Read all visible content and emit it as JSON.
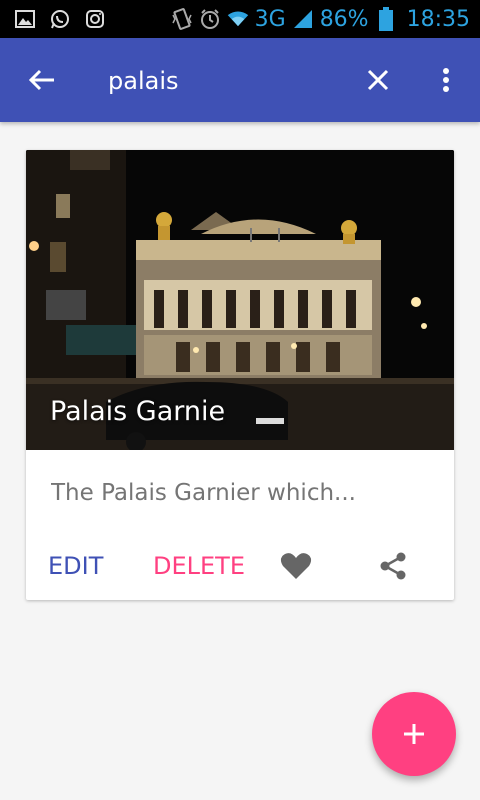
{
  "status_bar": {
    "network": "3G",
    "battery": "86%",
    "time": "18:35",
    "icons": [
      "gallery-icon",
      "whatsapp-icon",
      "instagram-icon",
      "vibrate-icon",
      "alarm-icon",
      "wifi-icon",
      "signal-icon",
      "battery-icon"
    ]
  },
  "app_bar": {
    "search_value": "palais",
    "color": "#3f51b5",
    "back_icon": "arrow-left-icon",
    "clear_icon": "close-icon",
    "more_icon": "more-vert-icon"
  },
  "card": {
    "title": "Palais Garnie",
    "description": "The Palais Garnier which...",
    "image_subject": "palais-garnier-night-photo",
    "actions": {
      "edit_label": "EDIT",
      "delete_label": "DELETE",
      "favorite_icon": "heart-icon",
      "share_icon": "share-icon"
    },
    "colors": {
      "edit": "#3f51b5",
      "delete": "#ff4081"
    }
  },
  "fab": {
    "icon": "plus-icon",
    "color": "#ff4081"
  }
}
